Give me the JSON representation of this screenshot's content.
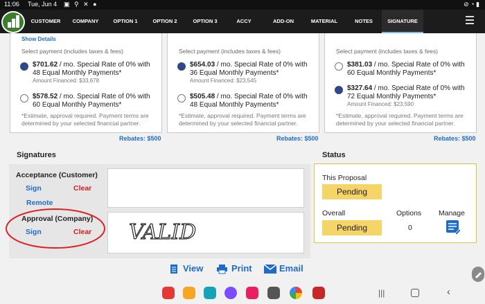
{
  "status_bar": {
    "time": "11:06",
    "date": "Tue, Jun 4",
    "icons": "▣ ⚲ ✕ ●",
    "right": "⊘ ◔ ▮"
  },
  "tabs": [
    "CUSTOMER",
    "COMPANY",
    "OPTION 1",
    "OPTION 2",
    "OPTION 3",
    "ACCY",
    "ADD-ON",
    "MATERIAL",
    "NOTES",
    "SIGNATURE"
  ],
  "active_tab": "SIGNATURE",
  "cards": [
    {
      "show_details": "Show Details",
      "select_label": "Select payment (includes taxes & fees)",
      "options": [
        {
          "price": "$701.62",
          "l1": " / mo. Special Rate of 0% with",
          "l2": "48 Equal Monthly Payments*",
          "l3": "Amount Financed: $33,678",
          "selected": true
        },
        {
          "price": "$578.52",
          "l1": " / mo. Special Rate of 0% with",
          "l2": "60 Equal Monthly Payments*",
          "l3": "",
          "selected": false
        }
      ],
      "fine": "*Estimate, approval required. Payment terms are determined by your selected financial partner.",
      "rebate": "Rebates: $500"
    },
    {
      "show_details": "",
      "select_label": "Select payment (includes taxes & fees)",
      "options": [
        {
          "price": "$654.03",
          "l1": " / mo. Special Rate of 0% with",
          "l2": "36 Equal Monthly Payments*",
          "l3": "Amount Financed: $23,545",
          "selected": true
        },
        {
          "price": "$505.48",
          "l1": " / mo. Special Rate of 0% with",
          "l2": "48 Equal Monthly Payments*",
          "l3": "",
          "selected": false
        }
      ],
      "fine": "*Estimate, approval required. Payment terms are determined by your selected financial partner.",
      "rebate": "Rebates: $500"
    },
    {
      "show_details": "",
      "select_label": "Select payment (includes taxes & fees)",
      "options": [
        {
          "price": "$381.03",
          "l1": " / mo. Special Rate of 0% with",
          "l2": "60 Equal Monthly Payments*",
          "l3": "",
          "selected": false
        },
        {
          "price": "$327.64",
          "l1": " / mo. Special Rate of 0% with",
          "l2": "72 Equal Monthly Payments*",
          "l3": "Amount Financed: $23,590",
          "selected": true
        }
      ],
      "fine": "*Estimate, approval required. Payment terms are determined by your selected financial partner.",
      "rebate": "Rebates: $500"
    }
  ],
  "signatures": {
    "heading": "Signatures",
    "acceptance_label": "Acceptance (Customer)",
    "approval_label": "Approval (Company)",
    "sign": "Sign",
    "clear": "Clear",
    "remote": "Remote",
    "signature_text": "VALID"
  },
  "status": {
    "heading": "Status",
    "this_proposal_label": "This Proposal",
    "this_proposal_value": "Pending",
    "overall_label": "Overall",
    "overall_value": "Pending",
    "options_label": "Options",
    "options_value": "0",
    "manage_label": "Manage"
  },
  "actions": {
    "view": "View",
    "print": "Print",
    "email": "Email"
  },
  "colors": {
    "accent": "#1e6cc8",
    "clear": "#d21f1f",
    "pending": "#f5d567",
    "radio_selected": "#2e4a86"
  }
}
